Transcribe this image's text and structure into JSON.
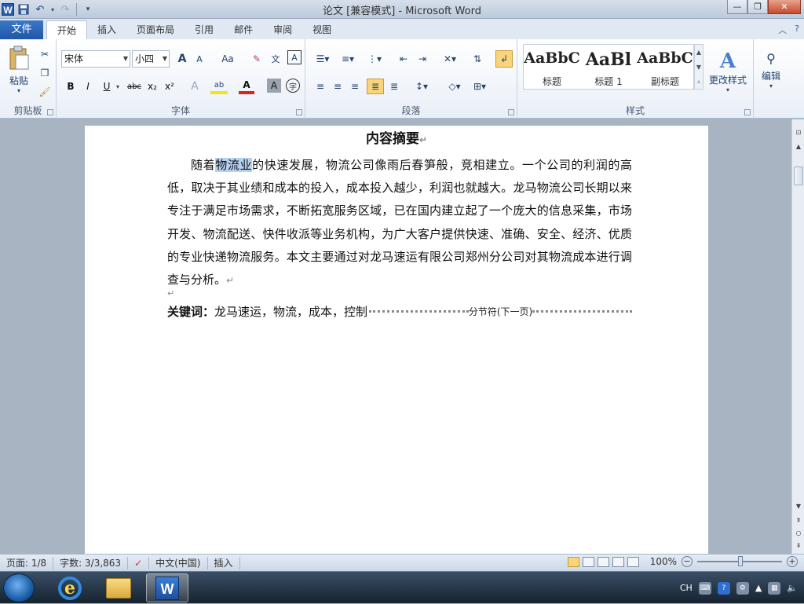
{
  "window": {
    "title": "论文 [兼容模式] - Microsoft Word",
    "qat_icons": [
      "word-logo-icon",
      "save-icon",
      "undo-icon",
      "redo-icon",
      "customize-icon"
    ]
  },
  "tabs": [
    {
      "label": "文件"
    },
    {
      "label": "开始"
    },
    {
      "label": "插入"
    },
    {
      "label": "页面布局"
    },
    {
      "label": "引用"
    },
    {
      "label": "邮件"
    },
    {
      "label": "审阅"
    },
    {
      "label": "视图"
    }
  ],
  "ribbon": {
    "clipboard": {
      "paste_label": "粘贴",
      "group_label": "剪贴板"
    },
    "font": {
      "font_name": "宋体",
      "font_size": "小四",
      "group_label": "字体",
      "bold": "B",
      "italic": "I",
      "underline": "U",
      "strike": "abc",
      "sub": "x₂",
      "sup": "x²",
      "grow": "A",
      "shrink": "A",
      "case": "Aa",
      "clear": "A",
      "text_effect": "A",
      "highlight": "ab",
      "font_color": "A",
      "char_shade": "A",
      "enclose": "字"
    },
    "paragraph": {
      "group_label": "段落"
    },
    "styles": {
      "group_label": "样式",
      "items": [
        {
          "sample": "AaBbC",
          "name": "标题"
        },
        {
          "sample": "AaBl",
          "name": "标题 1"
        },
        {
          "sample": "AaBbC",
          "name": "副标题"
        }
      ],
      "change_label": "更改样式"
    },
    "editing": {
      "label": "编辑"
    }
  },
  "document": {
    "heading": "内容摘要",
    "para_before": "随着",
    "para_selected": "物流业",
    "para_after": "的快速发展，物流公司像雨后春笋般，竞相建立。一个公司的利润的高低，取决于其业绩和成本的投入，成本投入越少，利润也就越大。龙马物流公司长期以来专注于满足市场需求，不断拓宽服务区域，已在国内建立起了一个庞大的信息采集，市场开发、物流配送、快件收派等业务机构，为广大客户提供快速、准确、安全、经济、优质的专业快递物流服务。本文主要通过对龙马速运有限公司郑州分公司对其物流成本进行调查与分析。",
    "para_mark": "↵",
    "keywords_label": "关键词：",
    "keywords": "龙马速运，物流，成本，控制",
    "section_break": "分节符(下一页)"
  },
  "status": {
    "page": "页面: 1/8",
    "words": "字数: 3/3,863",
    "language": "中文(中国)",
    "mode": "插入",
    "zoom": "100%",
    "zoom_level": 100
  },
  "taskbar": {
    "apps": [
      "ie-icon",
      "explorer-icon",
      "word-icon"
    ],
    "tray_lang": "CH"
  }
}
